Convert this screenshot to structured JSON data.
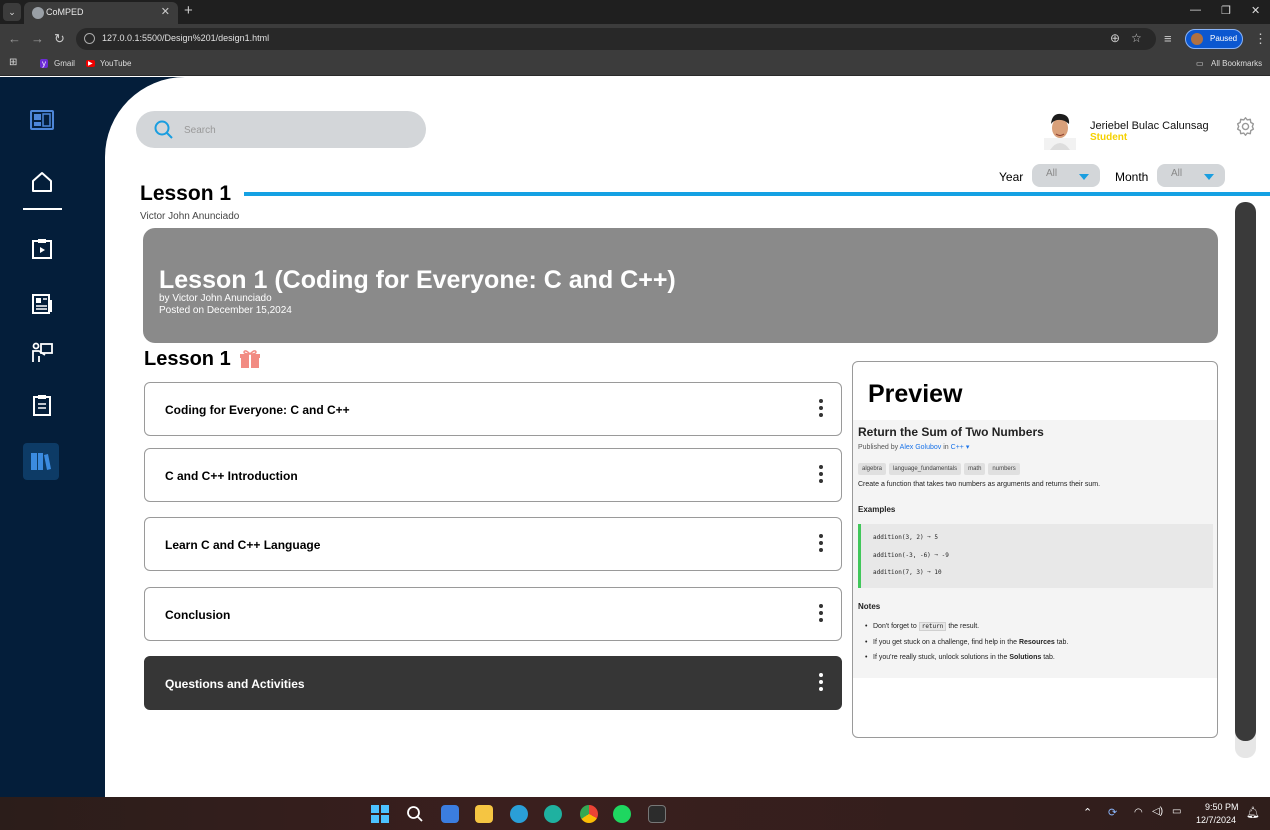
{
  "browser": {
    "tab_title": "CoMPED",
    "url": "127.0.0.1:5500/Design%201/design1.html",
    "profile_status": "Paused",
    "bookmarks": [
      "Gmail",
      "YouTube"
    ],
    "all_bookmarks": "All Bookmarks"
  },
  "search": {
    "placeholder": "Search"
  },
  "user": {
    "name": "Jeriebel Bulac Calunsag",
    "role": "Student"
  },
  "filters": {
    "year_label": "Year",
    "year_value": "All",
    "month_label": "Month",
    "month_value": "All"
  },
  "page": {
    "title": "Lesson 1",
    "author": "Victor John Anunciado"
  },
  "banner": {
    "title": "Lesson 1 (Coding for Everyone: C and C++)",
    "by": "by Victor John Anunciado",
    "posted": "Posted on December 15,2024"
  },
  "section": {
    "title": "Lesson 1"
  },
  "lessons": [
    {
      "label": "Coding for Everyone: C and C++"
    },
    {
      "label": "C and C++ Introduction"
    },
    {
      "label": "Learn C and C++ Language"
    },
    {
      "label": "Conclusion"
    },
    {
      "label": "Questions and Activities"
    }
  ],
  "preview": {
    "heading": "Preview",
    "title": "Return the Sum of Two Numbers",
    "published_by": "Published by",
    "author": "Alex Golubov",
    "in_word": "in",
    "language": "C++ ▾",
    "tags": [
      "algebra",
      "language_fundamentals",
      "math",
      "numbers"
    ],
    "description": "Create a function that takes two numbers as arguments and returns their sum.",
    "examples_heading": "Examples",
    "examples": [
      "addition(3, 2) ➞ 5",
      "addition(-3, -6) ➞ -9",
      "addition(7, 3) ➞ 10"
    ],
    "notes_heading": "Notes",
    "note1_pre": "Don't forget to",
    "note1_code": "return",
    "note1_post": "the result.",
    "note2_pre": "If you get stuck on a challenge, find help in the",
    "note2_bold": "Resources",
    "note2_post": "tab.",
    "note3_pre": "If you're really stuck, unlock solutions in the",
    "note3_bold": "Solutions",
    "note3_post": "tab."
  },
  "taskbar": {
    "time": "9:50 PM",
    "date": "12/7/2024"
  },
  "colors": {
    "sidebar": "#041e3a",
    "accent": "#15a1e3",
    "role": "#f5d100",
    "banner": "#8a8a8a",
    "dark_card": "#363636"
  }
}
